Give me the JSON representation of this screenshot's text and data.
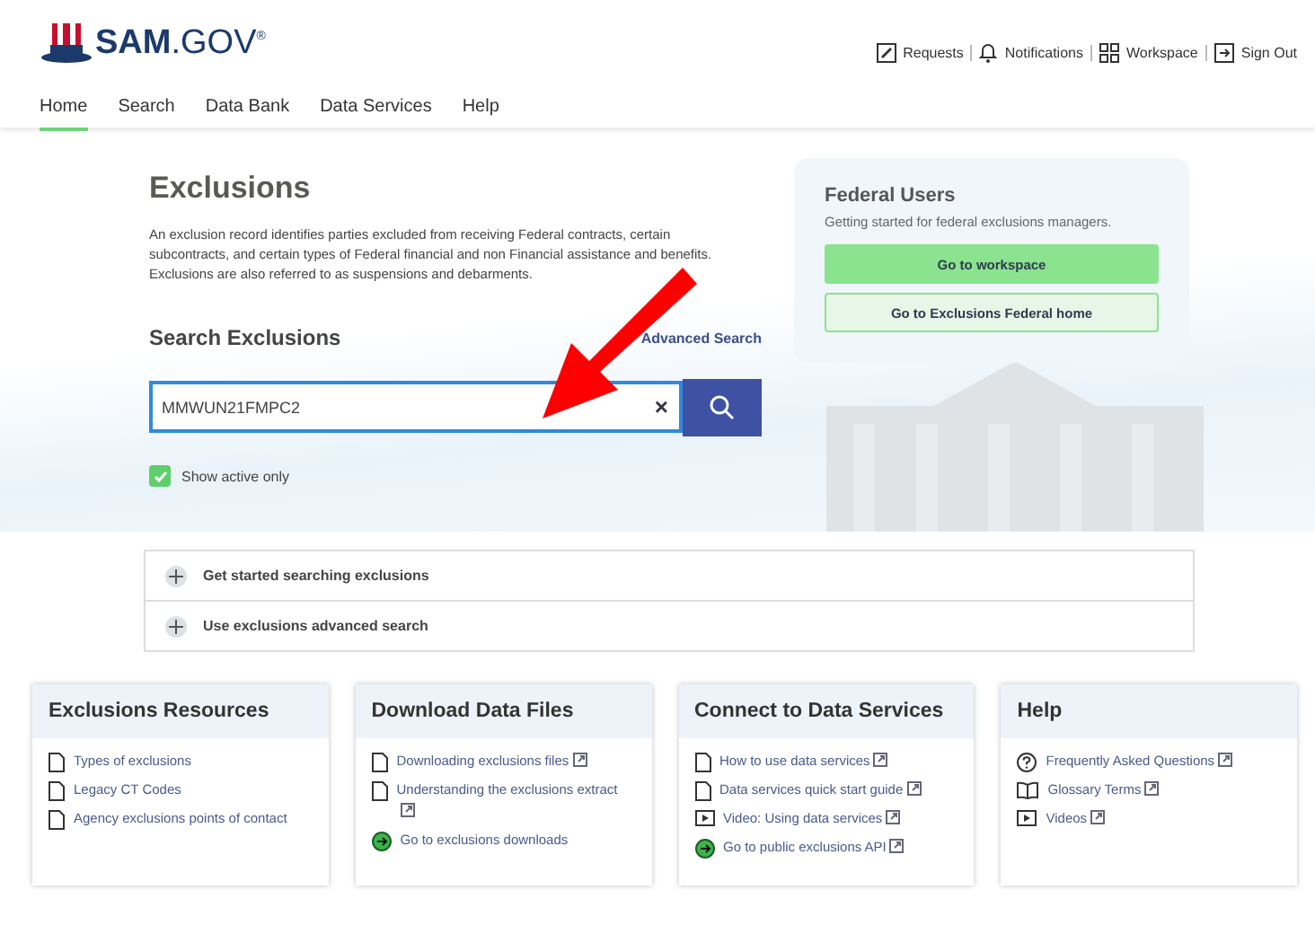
{
  "header": {
    "logo_text": "SAM",
    "logo_suffix": ".GOV",
    "logo_mark": "®",
    "utility_links": [
      {
        "label": "Requests",
        "kind": "edit"
      },
      {
        "label": "Notifications",
        "kind": "bell"
      },
      {
        "label": "Workspace",
        "kind": "grid"
      },
      {
        "label": "Sign Out",
        "kind": "signout"
      }
    ]
  },
  "nav": [
    {
      "label": "Home",
      "selected": true
    },
    {
      "label": "Search",
      "selected": false
    },
    {
      "label": "Data Bank",
      "selected": false
    },
    {
      "label": "Data Services",
      "selected": false
    },
    {
      "label": "Help",
      "selected": false
    }
  ],
  "hero": {
    "title": "Exclusions",
    "description": "An exclusion record identifies parties excluded from receiving Federal contracts, certain subcontracts, and certain types of Federal financial and non Financial assistance and benefits. Exclusions are also referred to as suspensions and debarments.",
    "search_title": "Search Exclusions",
    "advanced_link": "Advanced Search",
    "search": {
      "value": "MMWUN21FMPC2",
      "clear": "×"
    },
    "active_only": {
      "label": "Show active only",
      "checked": true
    }
  },
  "federal_users": {
    "title": "Federal Users",
    "subtitle": "Getting started for federal exclusions managers.",
    "buttons": [
      {
        "label": "Go to workspace",
        "kind": "primary"
      },
      {
        "label": "Go to Exclusions Federal home",
        "kind": "outline"
      }
    ]
  },
  "accordion": [
    {
      "label": "Get started searching exclusions",
      "expanded": false
    },
    {
      "label": "Use exclusions advanced search",
      "expanded": false
    }
  ],
  "cards": [
    {
      "title": "Exclusions Resources",
      "links": [
        {
          "label": "Types of exclusions",
          "kind": "doc",
          "external": false
        },
        {
          "label": "Legacy CT Codes",
          "kind": "doc",
          "external": false
        },
        {
          "label": "Agency exclusions points of contact",
          "kind": "doc",
          "external": false
        }
      ]
    },
    {
      "title": "Download Data Files",
      "links": [
        {
          "label": "Downloading exclusions files",
          "kind": "doc",
          "external": true
        },
        {
          "label": "Understanding the exclusions extract",
          "kind": "doc",
          "external": true
        },
        {
          "label": "Go to exclusions downloads",
          "kind": "go",
          "external": false
        }
      ]
    },
    {
      "title": "Connect to Data Services",
      "links": [
        {
          "label": "How to use data services",
          "kind": "doc",
          "external": true
        },
        {
          "label": "Data services quick start guide",
          "kind": "doc",
          "external": true
        },
        {
          "label": "Video: Using data services",
          "kind": "video",
          "external": true
        },
        {
          "label": "Go to public exclusions API",
          "kind": "go",
          "external": true
        }
      ]
    },
    {
      "title": "Help",
      "links": [
        {
          "label": "Frequently Asked Questions",
          "kind": "faq",
          "external": true
        },
        {
          "label": "Glossary Terms",
          "kind": "book",
          "external": true
        },
        {
          "label": "Videos",
          "kind": "video",
          "external": true
        }
      ]
    }
  ],
  "annotation": {
    "kind": "arrow"
  }
}
